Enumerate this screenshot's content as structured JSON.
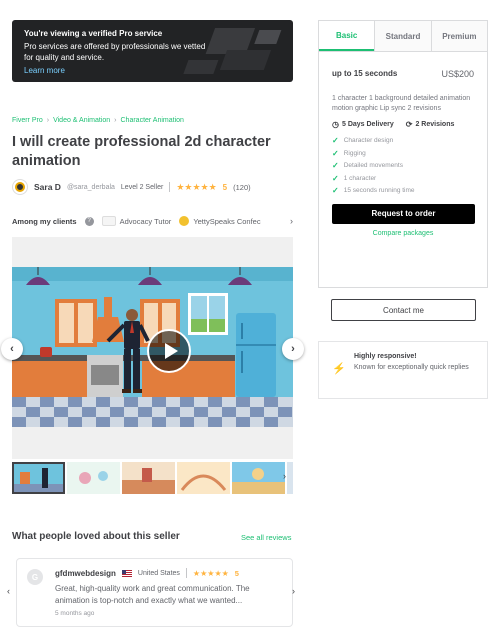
{
  "pro_banner": {
    "title": "You're viewing a verified Pro service",
    "text": "Pro services are offered by professionals we vetted for quality and service.",
    "link": "Learn more"
  },
  "breadcrumb": [
    "Fiverr Pro",
    "Video & Animation",
    "Character Animation"
  ],
  "gig_title": "I will create professional 2d character animation",
  "seller": {
    "name": "Sara D",
    "handle": "@sara_derbala",
    "level": "Level 2 Seller",
    "stars": "★★★★★",
    "rating": "5",
    "reviews": "(120)"
  },
  "clients": {
    "label": "Among my clients",
    "items": [
      "Advocacy Tutor",
      "YettySpeaks Confec"
    ]
  },
  "gallery": {
    "thumbnail_count": 6
  },
  "loved": {
    "title": "What people loved about this seller",
    "see_all": "See all reviews"
  },
  "review": {
    "initial": "G",
    "user": "gfdmwebdesign",
    "country": "United States",
    "stars": "★★★★★",
    "score": "5",
    "text": "Great, high-quality work and great communication. The animation is top-notch and exactly what we wanted...",
    "time": "5 months ago"
  },
  "package": {
    "tabs": [
      "Basic",
      "Standard",
      "Premium"
    ],
    "active_tab": "Basic",
    "name": "up to 15 seconds",
    "price": "US$200",
    "description": "1 character 1 background detailed animation motion graphic Lip sync 2 revisions",
    "delivery": "5 Days Delivery",
    "revisions": "2 Revisions",
    "features": [
      "Character design",
      "Rigging",
      "Detailed movements",
      "1 character",
      "15 seconds running time"
    ],
    "order_button": "Request to order",
    "compare_link": "Compare packages"
  },
  "contact_button": "Contact me",
  "responsive": {
    "title": "Highly responsive!",
    "text": "Known for exceptionally quick replies"
  },
  "colors": {
    "accent": "#1dbf73",
    "star": "#ffb33e",
    "banner_bg": "#222325"
  }
}
